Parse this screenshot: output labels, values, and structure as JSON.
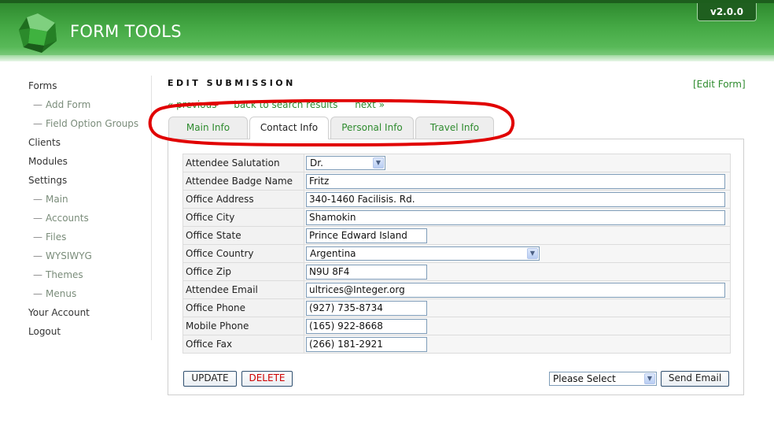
{
  "header": {
    "app_title": "FORM TOOLS",
    "version": "v2.0.0",
    "logo_icon": "green-gem-icon",
    "colors": {
      "brand_green": "#44a844",
      "dark_green": "#1d5e1d",
      "link_green": "#2e8b2e"
    }
  },
  "sidebar": {
    "items": [
      {
        "label": "Forms",
        "sub": false
      },
      {
        "label": "Add Form",
        "sub": true
      },
      {
        "label": "Field Option Groups",
        "sub": true
      },
      {
        "label": "Clients",
        "sub": false
      },
      {
        "label": "Modules",
        "sub": false
      },
      {
        "label": "Settings",
        "sub": false
      },
      {
        "label": "Main",
        "sub": true
      },
      {
        "label": "Accounts",
        "sub": true
      },
      {
        "label": "Files",
        "sub": true
      },
      {
        "label": "WYSIWYG",
        "sub": true
      },
      {
        "label": "Themes",
        "sub": true
      },
      {
        "label": "Menus",
        "sub": true
      },
      {
        "label": "Your Account",
        "sub": false
      },
      {
        "label": "Logout",
        "sub": false
      }
    ],
    "sub_prefix": "—"
  },
  "main": {
    "page_title": "EDIT SUBMISSION",
    "edit_form_link": "[Edit Form]",
    "nav": {
      "previous": "« previous",
      "back": "back to search results",
      "next": "next »"
    },
    "tabs": [
      {
        "label": "Main Info",
        "active": false
      },
      {
        "label": "Contact Info",
        "active": true
      },
      {
        "label": "Personal Info",
        "active": false
      },
      {
        "label": "Travel Info",
        "active": false
      }
    ],
    "fields": [
      {
        "label": "Attendee Salutation",
        "value": "Dr.",
        "kind": "select"
      },
      {
        "label": "Attendee Badge Name",
        "value": "Fritz",
        "kind": "text"
      },
      {
        "label": "Office Address",
        "value": "340-1460 Facilisis. Rd.",
        "kind": "text"
      },
      {
        "label": "Office City",
        "value": "Shamokin",
        "kind": "text"
      },
      {
        "label": "Office State",
        "value": "Prince Edward Island",
        "kind": "text"
      },
      {
        "label": "Office Country",
        "value": "Argentina",
        "kind": "select"
      },
      {
        "label": "Office Zip",
        "value": "N9U 8F4",
        "kind": "text"
      },
      {
        "label": "Attendee Email",
        "value": "ultrices@Integer.org",
        "kind": "text"
      },
      {
        "label": "Office Phone",
        "value": "(927) 735-8734",
        "kind": "text"
      },
      {
        "label": "Mobile Phone",
        "value": "(165) 922-8668",
        "kind": "text"
      },
      {
        "label": "Office Fax",
        "value": "(266) 181-2921",
        "kind": "text"
      }
    ],
    "buttons": {
      "update": "UPDATE",
      "delete": "DELETE",
      "send_email": "Send Email"
    },
    "email_select": {
      "value": "Please Select"
    }
  },
  "annotation": {
    "color": "#e10000",
    "shape": "hand-drawn-ellipse"
  }
}
